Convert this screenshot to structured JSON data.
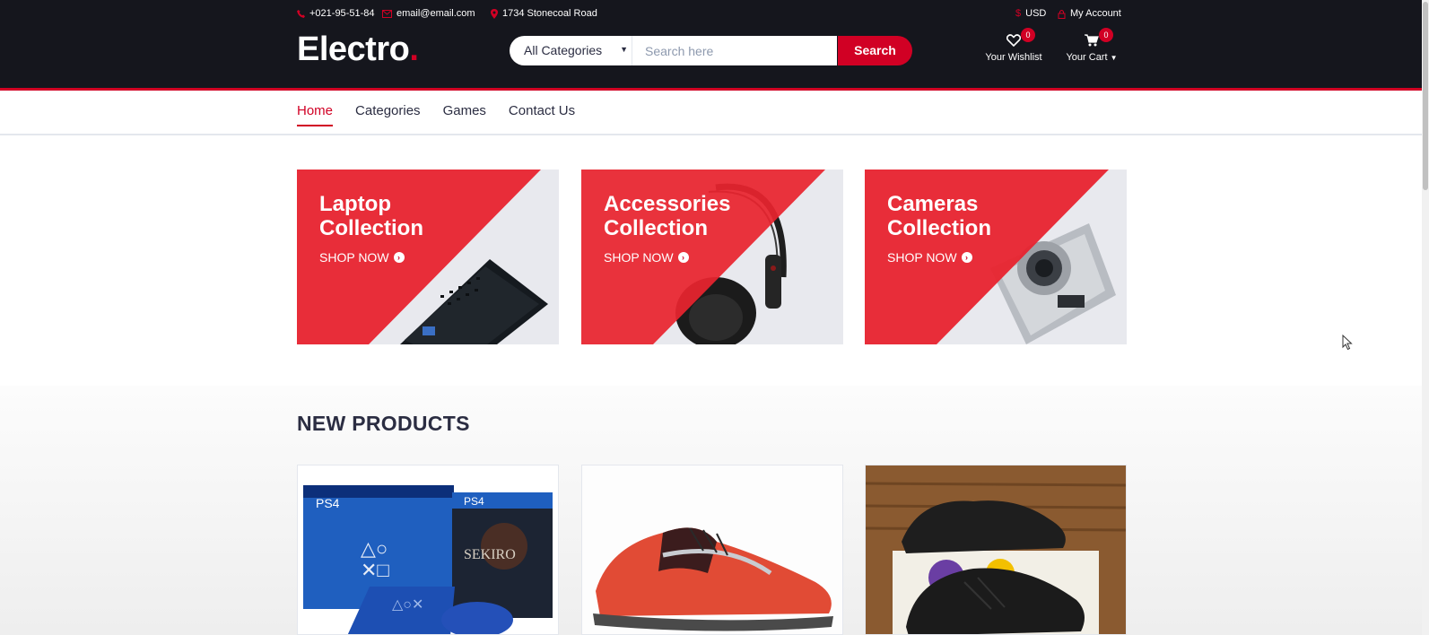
{
  "topbar": {
    "phone": "+021-95-51-84",
    "email": "email@email.com",
    "address": "1734 Stonecoal Road",
    "currency": "USD",
    "account": "My Account"
  },
  "logo": {
    "text": "Electro",
    "dot": "."
  },
  "search": {
    "category": "All Categories",
    "placeholder": "Search here",
    "button": "Search"
  },
  "wishlist": {
    "label": "Your Wishlist",
    "count": "0"
  },
  "cart": {
    "label": "Your Cart",
    "count": "0"
  },
  "nav": {
    "items": [
      {
        "label": "Home",
        "active": true
      },
      {
        "label": "Categories"
      },
      {
        "label": "Games"
      },
      {
        "label": "Contact Us"
      }
    ]
  },
  "collections": [
    {
      "title_line1": "Laptop",
      "title_line2": "Collection",
      "cta": "SHOP NOW",
      "image": "laptop"
    },
    {
      "title_line1": "Accessories",
      "title_line2": "Collection",
      "cta": "SHOP NOW",
      "image": "headphones"
    },
    {
      "title_line1": "Cameras",
      "title_line2": "Collection",
      "cta": "SHOP NOW",
      "image": "camera"
    }
  ],
  "products_section": {
    "title": "NEW PRODUCTS",
    "products": [
      {
        "image": "ps4-bundle",
        "box_texts": [
          "PS4",
          "PS4",
          "SEKIRO"
        ]
      },
      {
        "image": "red-running-shoe"
      },
      {
        "image": "black-sneakers"
      }
    ]
  },
  "colors": {
    "brand": "#d10024",
    "header_bg": "#15161d",
    "text": "#2b2d42"
  }
}
